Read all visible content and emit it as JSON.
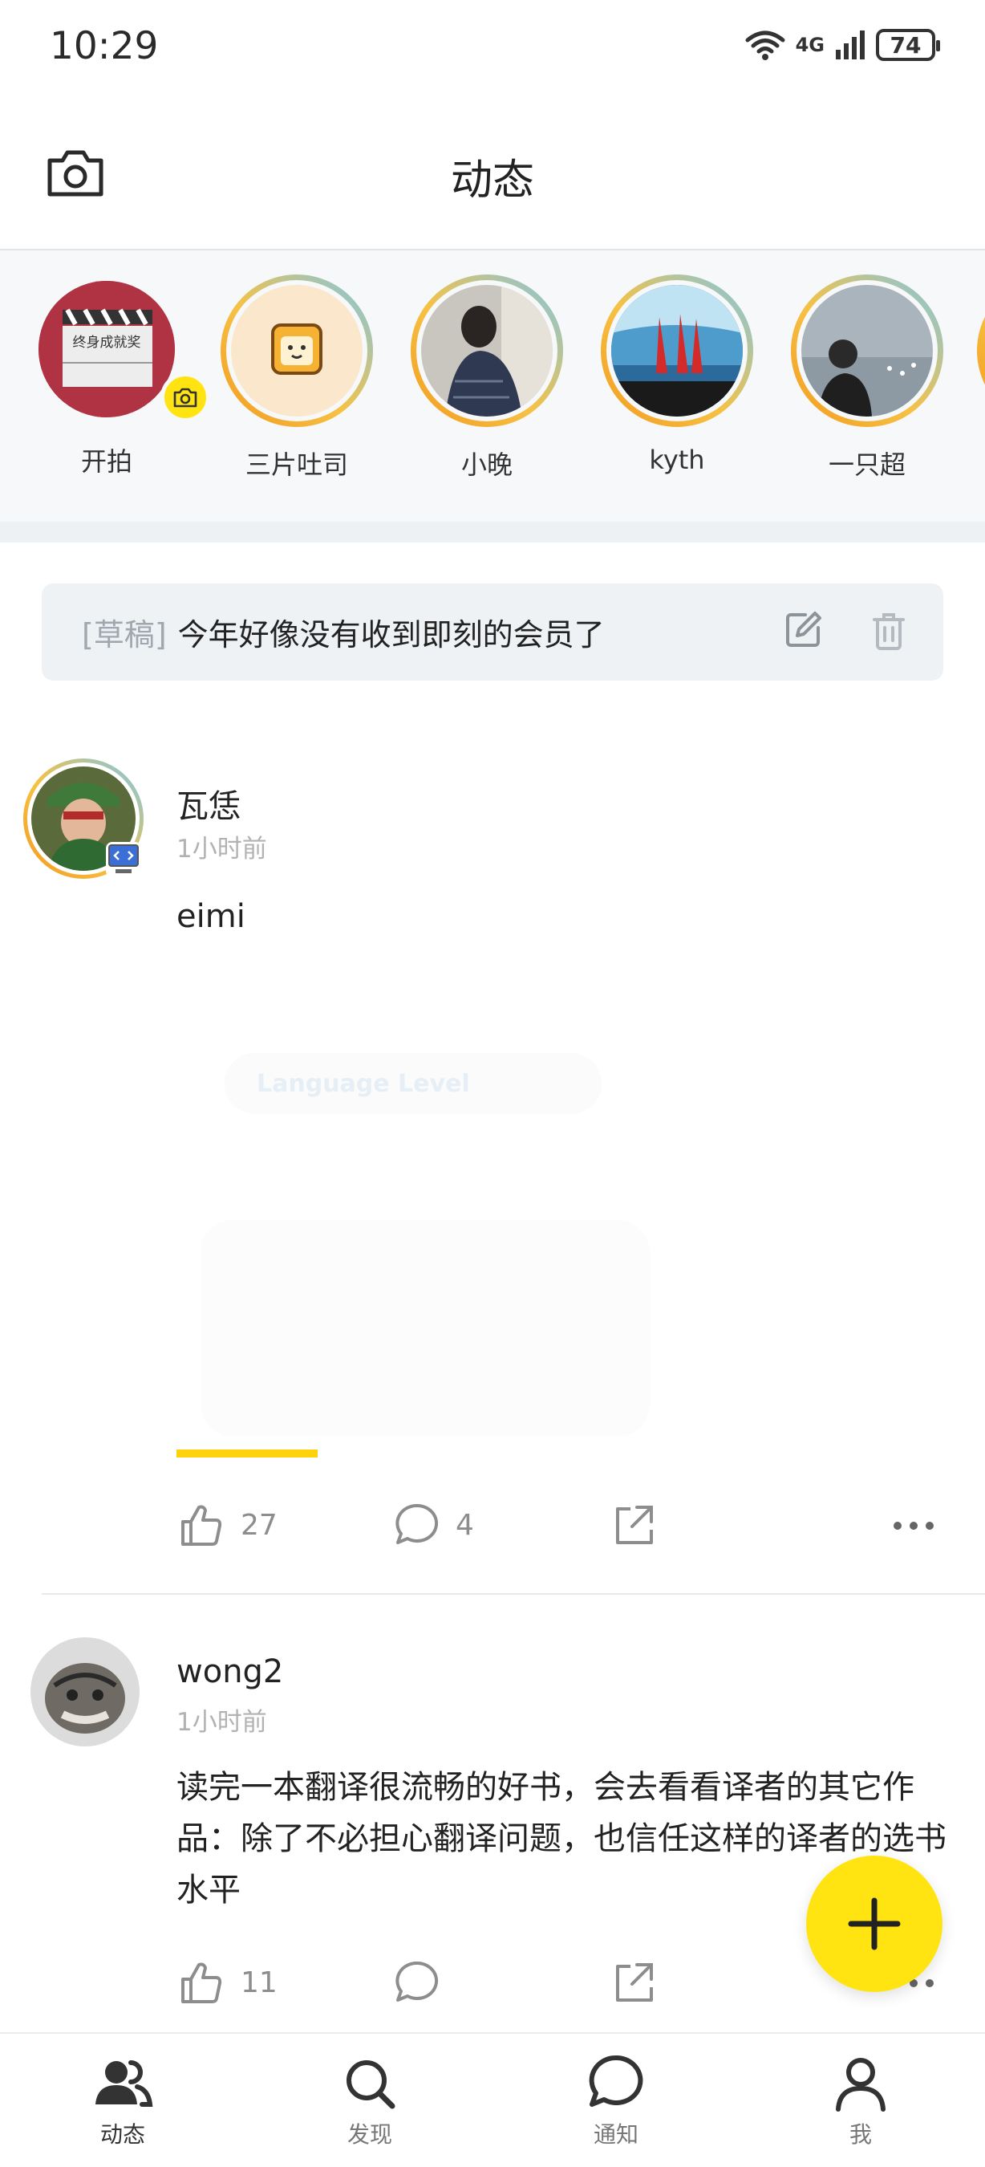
{
  "status_bar": {
    "time": "10:29",
    "network": "4G",
    "battery": "74"
  },
  "header": {
    "title": "动态",
    "camera_icon": "camera-icon"
  },
  "stories": [
    {
      "label": "开拍",
      "image_text": "终身成就奖"
    },
    {
      "label": "三片吐司"
    },
    {
      "label": "小晚"
    },
    {
      "label": "kyth"
    },
    {
      "label": "一只超"
    }
  ],
  "draft": {
    "tag": "[草稿]",
    "text": "今年好像没有收到即刻的会员了"
  },
  "posts": [
    {
      "author": "瓦恁",
      "time": "1小时前",
      "text": "eimi",
      "image_caption": "Language Level",
      "likes": "27",
      "comments": "4"
    },
    {
      "author": "wong2",
      "time": "1小时前",
      "text": "读完一本翻译很流畅的好书，会去看看译者的其它作品：除了不必担心翻译问题，也信任这样的译者的选书水平",
      "likes": "11",
      "comments": ""
    }
  ],
  "bottom_nav": [
    {
      "label": "动态",
      "icon": "users-icon",
      "active": true
    },
    {
      "label": "发现",
      "icon": "search-icon",
      "active": false
    },
    {
      "label": "通知",
      "icon": "chat-bubble-icon",
      "active": false
    },
    {
      "label": "我",
      "icon": "person-icon",
      "active": false
    }
  ],
  "colors": {
    "accent": "#ffe411",
    "background": "#ffffff",
    "muted": "#8d8d8d"
  }
}
